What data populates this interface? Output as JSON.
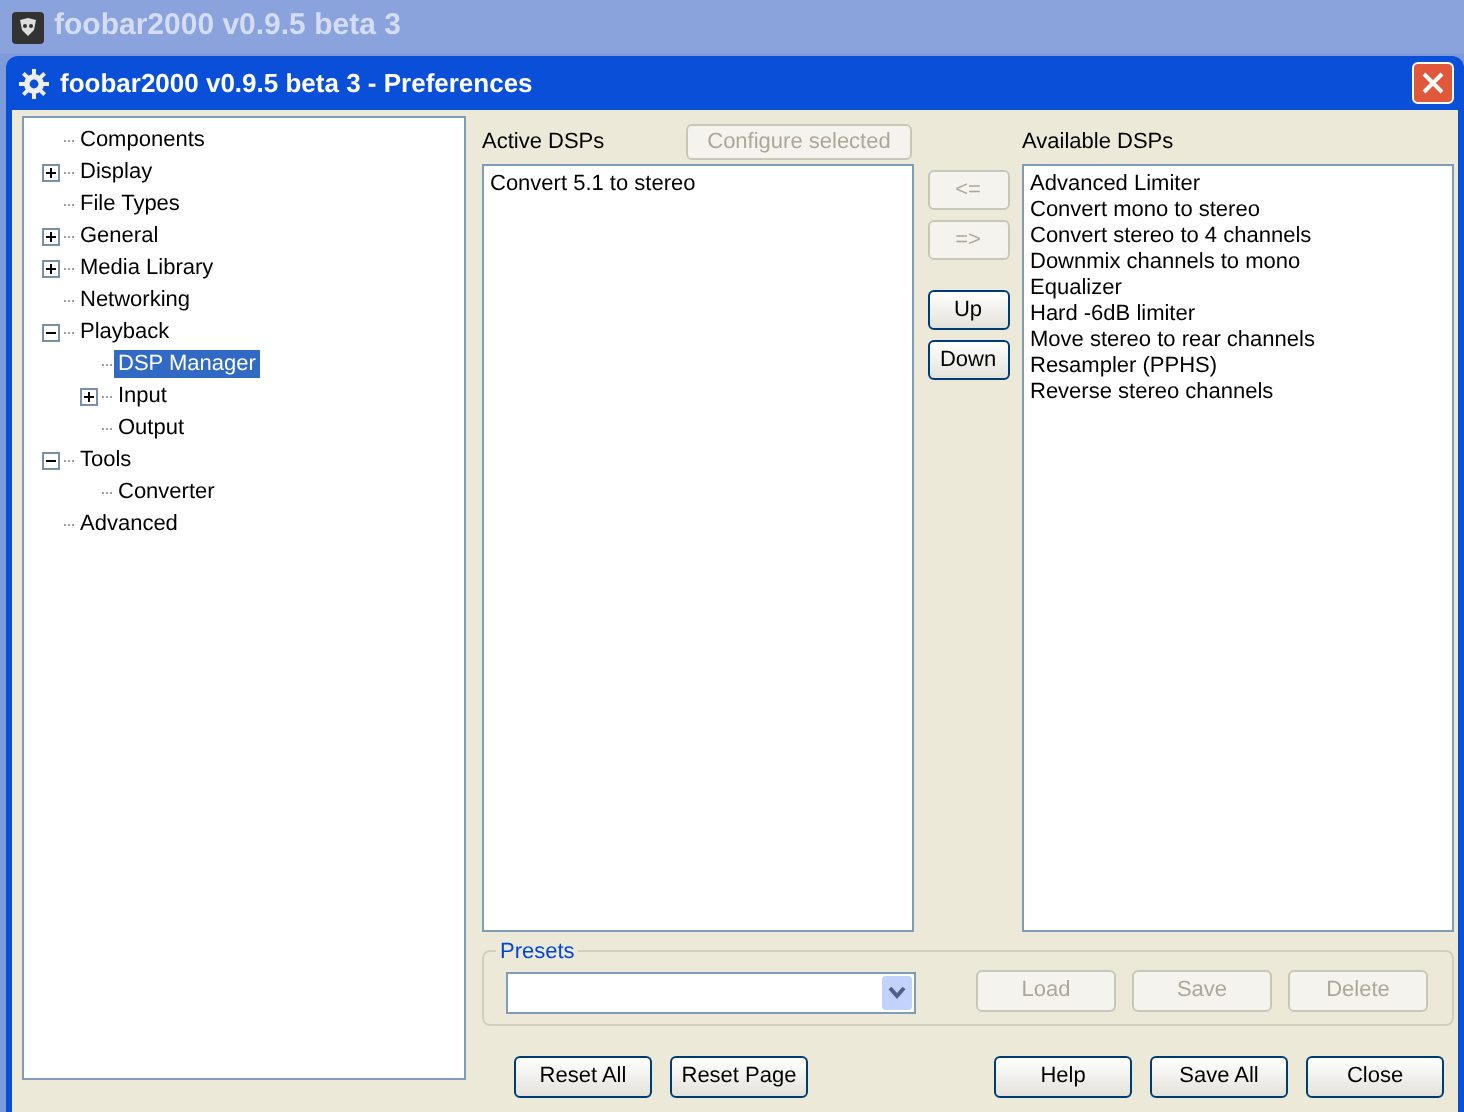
{
  "background_window": {
    "title": "foobar2000 v0.9.5 beta 3"
  },
  "window": {
    "title": "foobar2000 v0.9.5 beta 3 - Preferences"
  },
  "tree": [
    {
      "label": "Components",
      "selected": false
    },
    {
      "label": "Display",
      "selected": false,
      "expanded": false
    },
    {
      "label": "File Types",
      "selected": false
    },
    {
      "label": "General",
      "selected": false,
      "expanded": false
    },
    {
      "label": "Media Library",
      "selected": false,
      "expanded": false
    },
    {
      "label": "Networking",
      "selected": false
    },
    {
      "label": "Playback",
      "selected": false,
      "expanded": true,
      "children": [
        {
          "label": "DSP Manager",
          "selected": true
        },
        {
          "label": "Input",
          "selected": false,
          "expanded": false
        },
        {
          "label": "Output",
          "selected": false
        }
      ]
    },
    {
      "label": "Tools",
      "selected": false,
      "expanded": true,
      "children": [
        {
          "label": "Converter",
          "selected": false
        }
      ]
    },
    {
      "label": "Advanced",
      "selected": false
    }
  ],
  "active_dsps": {
    "label": "Active DSPs",
    "configure_button": {
      "label": "Configure selected",
      "disabled": true
    },
    "items": [
      "Convert 5.1 to stereo"
    ]
  },
  "move_buttons": [
    {
      "label": "<=",
      "disabled": true
    },
    {
      "label": "=>",
      "disabled": true
    },
    {
      "label": "Up",
      "disabled": false
    },
    {
      "label": "Down",
      "disabled": false
    }
  ],
  "available_dsps": {
    "label": "Available DSPs",
    "items": [
      "Advanced Limiter",
      "Convert mono to stereo",
      "Convert stereo to 4 channels",
      "Downmix channels to mono",
      "Equalizer",
      "Hard -6dB limiter",
      "Move stereo to rear channels",
      "Resampler (PPHS)",
      "Reverse stereo channels"
    ]
  },
  "presets": {
    "label": "Presets",
    "buttons": [
      {
        "label": "Load",
        "disabled": true
      },
      {
        "label": "Save",
        "disabled": true
      },
      {
        "label": "Delete",
        "disabled": true
      }
    ]
  },
  "footer_left": [
    {
      "label": "Reset All",
      "disabled": false
    },
    {
      "label": "Reset Page",
      "disabled": false
    }
  ],
  "footer_right": [
    {
      "label": "Help",
      "disabled": false
    },
    {
      "label": "Save All",
      "disabled": false
    },
    {
      "label": "Close",
      "disabled": false
    }
  ]
}
